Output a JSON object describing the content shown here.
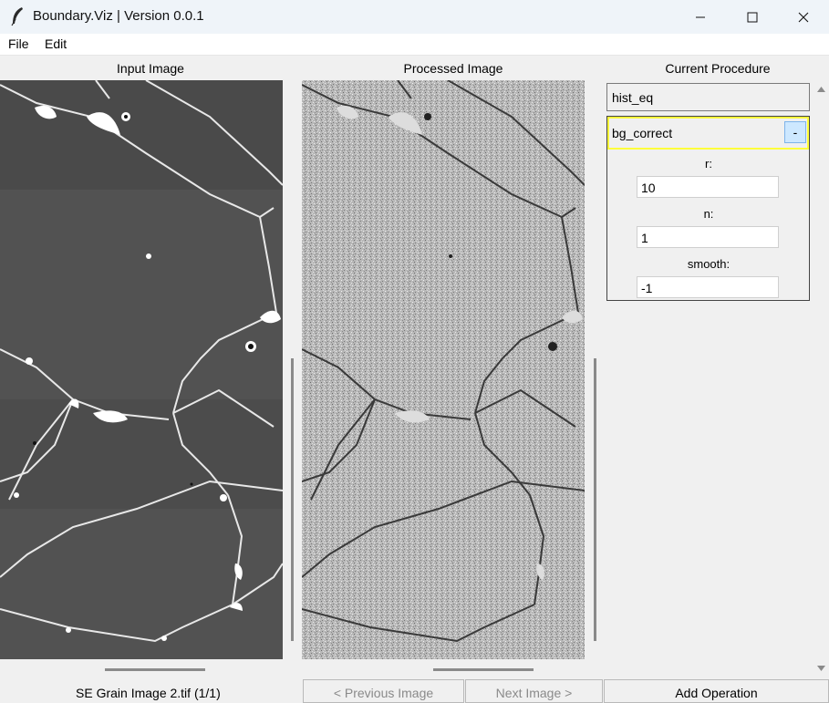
{
  "window": {
    "title": "Boundary.Viz | Version 0.0.1"
  },
  "menu": [
    "File",
    "Edit"
  ],
  "panels": {
    "input_label": "Input Image",
    "processed_label": "Processed Image",
    "procedure_label": "Current Procedure"
  },
  "procedure": {
    "operations": [
      {
        "name": "hist_eq"
      },
      {
        "name": "bg_correct",
        "remove_label": "-",
        "params": [
          {
            "label": "r:",
            "value": "10"
          },
          {
            "label": "n:",
            "value": "1"
          },
          {
            "label": "smooth:",
            "value": "-1"
          }
        ]
      }
    ]
  },
  "footer": {
    "filename": "SE Grain Image 2.tif (1/1)",
    "prev": "< Previous Image",
    "next": "Next Image >",
    "add": "Add Operation"
  },
  "colors": {
    "highlight": "#ffff3b",
    "remove_button_bg": "#cde8ff",
    "disabled_text": "#8a8a8a"
  }
}
